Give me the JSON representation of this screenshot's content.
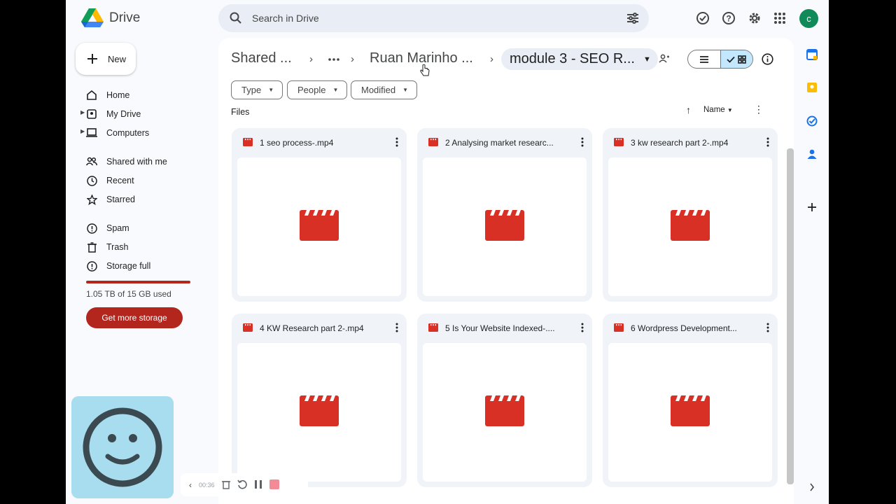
{
  "app": {
    "name": "Drive"
  },
  "search": {
    "placeholder": "Search in Drive"
  },
  "header": {
    "avatar_letter": "c"
  },
  "sidebar": {
    "new_label": "New",
    "items": [
      {
        "label": "Home",
        "icon": "home-icon"
      },
      {
        "label": "My Drive",
        "icon": "my-drive-icon"
      },
      {
        "label": "Computers",
        "icon": "computers-icon"
      },
      {
        "label": "Shared with me",
        "icon": "shared-icon"
      },
      {
        "label": "Recent",
        "icon": "clock-icon"
      },
      {
        "label": "Starred",
        "icon": "star-icon"
      },
      {
        "label": "Spam",
        "icon": "spam-icon"
      },
      {
        "label": "Trash",
        "icon": "trash-icon"
      },
      {
        "label": "Storage full",
        "icon": "storage-icon"
      }
    ],
    "storage_text": "1.05 TB of 15 GB used",
    "storage_button": "Get more storage"
  },
  "breadcrumb": {
    "items": [
      "Shared ...",
      "Ruan Marinho ..."
    ],
    "current": "module 3 - SEO R..."
  },
  "filters": [
    "Type",
    "People",
    "Modified"
  ],
  "files_label": "Files",
  "sort": {
    "label": "Name"
  },
  "files": [
    {
      "name": "1 seo process-.mp4"
    },
    {
      "name": "2 Analysing market researc..."
    },
    {
      "name": "3 kw research part 2-.mp4"
    },
    {
      "name": "4 KW Research part 2-.mp4"
    },
    {
      "name": "5 Is Your Website Indexed-...."
    },
    {
      "name": "6 Wordpress Development..."
    }
  ],
  "recorder": {
    "time": "00:36"
  },
  "colors": {
    "video_red": "#d93025",
    "storage_red": "#b3261e",
    "grid_selected": "#c2e7ff"
  }
}
